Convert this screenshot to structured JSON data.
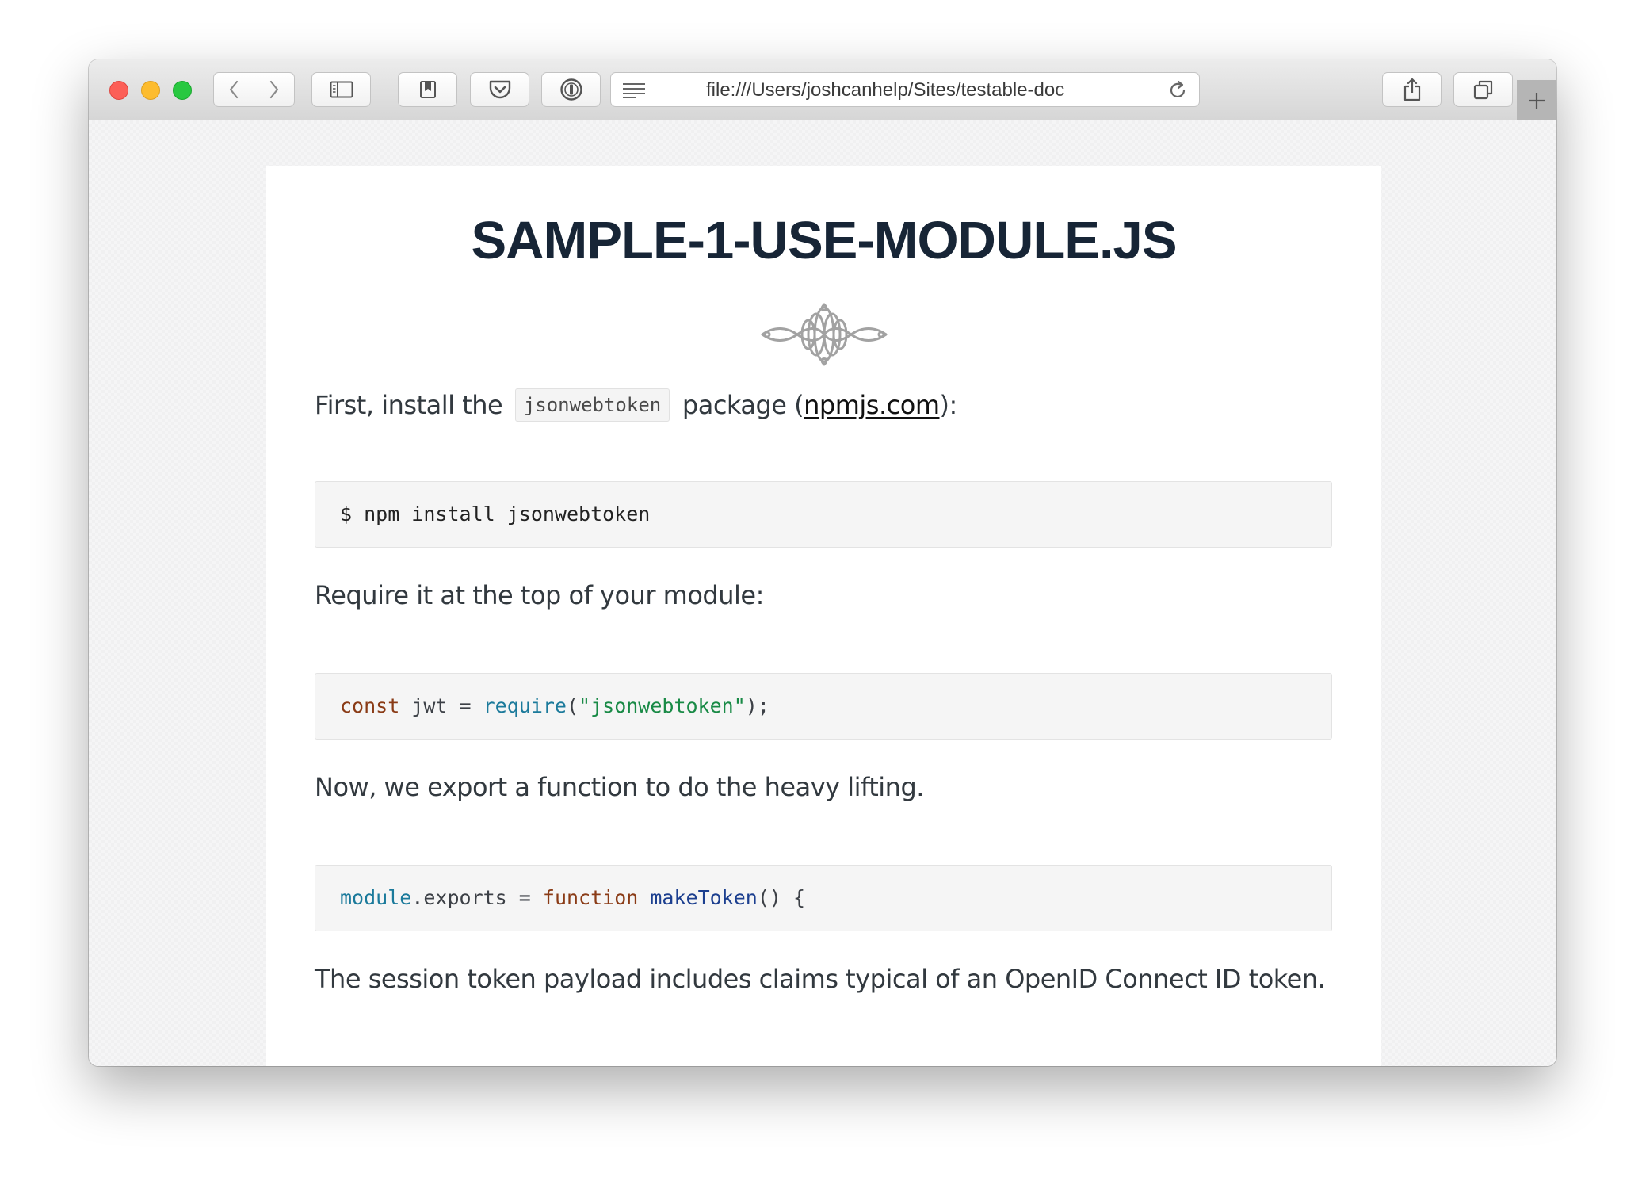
{
  "browser": {
    "url": "file:///Users/joshcanhelp/Sites/testable-doc",
    "buttons": {
      "back": "back-icon",
      "forward": "forward-icon",
      "sidebar": "sidebar-icon",
      "bookmarks": "bookmark-icon",
      "pocket": "pocket-icon",
      "password_manager": "1password-icon",
      "reader": "reader-icon",
      "reload": "reload-icon",
      "share": "share-icon",
      "tabs": "tabs-icon",
      "new_tab": "plus-icon"
    }
  },
  "page": {
    "title": "SAMPLE-1-USE-MODULE.JS",
    "para1": {
      "before": "First, install the ",
      "code": "jsonwebtoken",
      "middle": " package (",
      "link": "npmjs.com",
      "after": "):"
    },
    "code1": {
      "text": "$ npm install jsonwebtoken"
    },
    "para2": "Require it at the top of your module:",
    "code2": {
      "kw": "const",
      "var": " jwt = ",
      "fn": "require",
      "open": "(",
      "str": "\"jsonwebtoken\"",
      "close": ");"
    },
    "para3": "Now, we export a function to do the heavy lifting.",
    "code3": {
      "obj": "module",
      "prop": ".exports = ",
      "kw": "function",
      "sp": " ",
      "name": "makeToken",
      "rest": "() {"
    },
    "para4": "The session token payload includes claims typical of an OpenID Connect ID token."
  },
  "colors": {
    "title": "#172536",
    "keyword": "#8a3b16",
    "builtin": "#1b7a9b",
    "string": "#198a46",
    "function_name": "#1c3f8f"
  }
}
